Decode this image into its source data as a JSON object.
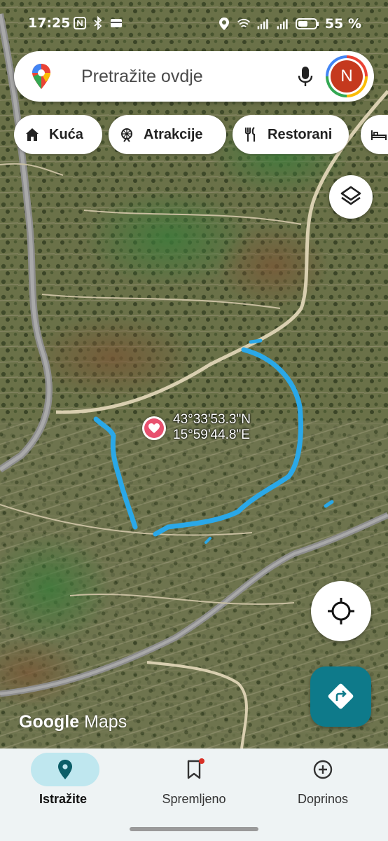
{
  "status_bar": {
    "time": "17:25",
    "battery": "55 %"
  },
  "search": {
    "placeholder": "Pretražite ovdje",
    "avatar_letter": "N"
  },
  "chips": [
    {
      "label": "Kuća",
      "icon": "home-icon"
    },
    {
      "label": "Atrakcije",
      "icon": "attractions-icon"
    },
    {
      "label": "Restorani",
      "icon": "restaurant-icon"
    },
    {
      "label": "",
      "icon": "hotel-icon"
    }
  ],
  "marker": {
    "lat": "43°33'53.3\"N",
    "lng": "15°59'44.8\"E",
    "icon": "heart-icon",
    "color": "#e8516f"
  },
  "route_color": "#2aa8e8",
  "watermark": {
    "brand": "Google",
    "product": "Maps"
  },
  "bottom_nav": [
    {
      "label": "Istražite",
      "icon": "explore-pin-icon",
      "active": true
    },
    {
      "label": "Spremljeno",
      "icon": "bookmark-icon",
      "active": false
    },
    {
      "label": "Doprinos",
      "icon": "add-circle-icon",
      "active": false
    }
  ],
  "accent": "#0e7a8a"
}
